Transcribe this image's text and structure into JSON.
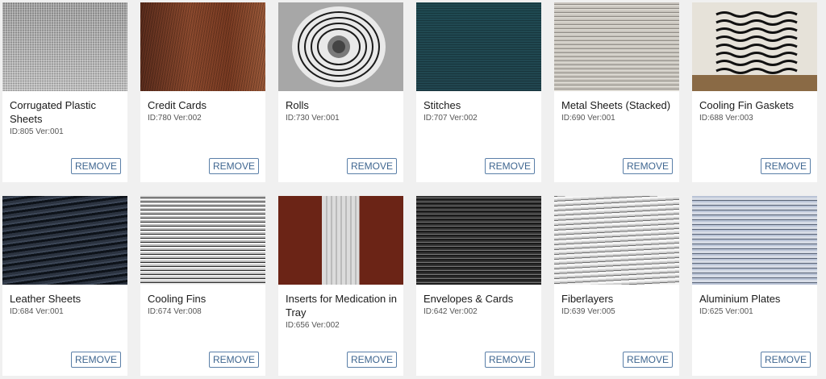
{
  "cards": [
    {
      "title": "Corrugated Plastic Sheets",
      "id": "ID:805 Ver:001",
      "remove_label": "REMOVE",
      "image": "corrugated-plastic-image"
    },
    {
      "title": "Credit Cards",
      "id": "ID:780 Ver:002",
      "remove_label": "REMOVE",
      "image": "credit-cards-image"
    },
    {
      "title": "Rolls",
      "id": "ID:730 Ver:001",
      "remove_label": "REMOVE",
      "image": "rolls-image"
    },
    {
      "title": "Stitches",
      "id": "ID:707 Ver:002",
      "remove_label": "REMOVE",
      "image": "stitches-image"
    },
    {
      "title": "Metal Sheets (Stacked)",
      "id": "ID:690 Ver:001",
      "remove_label": "REMOVE",
      "image": "metal-sheets-image"
    },
    {
      "title": "Cooling Fin Gaskets",
      "id": "ID:688 Ver:003",
      "remove_label": "REMOVE",
      "image": "cooling-fin-gaskets-image"
    },
    {
      "title": "Leather Sheets",
      "id": "ID:684 Ver:001",
      "remove_label": "REMOVE",
      "image": "leather-sheets-image"
    },
    {
      "title": "Cooling Fins",
      "id": "ID:674 Ver:008",
      "remove_label": "REMOVE",
      "image": "cooling-fins-image"
    },
    {
      "title": "Inserts for Medication in Tray",
      "id": "ID:656 Ver:002",
      "remove_label": "REMOVE",
      "image": "medication-inserts-image"
    },
    {
      "title": "Envelopes & Cards",
      "id": "ID:642 Ver:002",
      "remove_label": "REMOVE",
      "image": "envelopes-cards-image"
    },
    {
      "title": "Fiberlayers",
      "id": "ID:639 Ver:005",
      "remove_label": "REMOVE",
      "image": "fiberlayers-image"
    },
    {
      "title": "Aluminium Plates",
      "id": "ID:625 Ver:001",
      "remove_label": "REMOVE",
      "image": "aluminium-plates-image"
    }
  ]
}
